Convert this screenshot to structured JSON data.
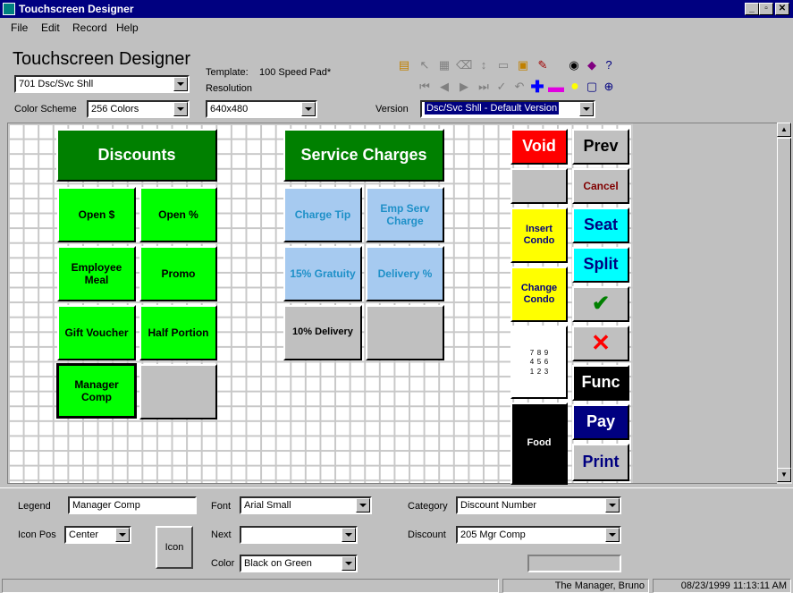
{
  "window": {
    "title": "Touchscreen Designer"
  },
  "menu": [
    "File",
    "Edit",
    "Record",
    "Help"
  ],
  "header": {
    "app_title": "Touchscreen Designer",
    "screen_select": "701  Dsc/Svc Shll",
    "template_label": "Template:",
    "template_value": "100 Speed Pad*",
    "resolution_label": "Resolution",
    "resolution_value": "640x480",
    "color_scheme_label": "Color Scheme",
    "color_scheme_value": "256 Colors",
    "version_label": "Version",
    "version_value": "Dsc/Svc Shll - Default Version"
  },
  "toolbar_icons": [
    "open-icon",
    "cursor-icon",
    "copy-icon",
    "delete-icon",
    "sort-icon",
    "paste-icon",
    "new-icon",
    "wand-icon",
    "find-icon",
    "book-icon",
    "help-icon",
    "first-icon",
    "prev-icon",
    "next-icon",
    "last-icon",
    "check-icon",
    "undo-icon",
    "add-icon",
    "remove-icon",
    "speech-icon",
    "monitor-icon",
    "network-icon"
  ],
  "touch_buttons": {
    "discounts": "Discounts",
    "service_charges": "Service Charges",
    "open_dollar": "Open $",
    "open_pct": "Open %",
    "employee_meal": "Employee Meal",
    "promo": "Promo",
    "gift_voucher": "Gift Voucher",
    "half_portion": "Half Portion",
    "manager_comp": "Manager Comp",
    "charge_tip": "Charge Tip",
    "emp_serv_charge": "Emp Serv Charge",
    "gratuity": "15% Gratuity",
    "delivery_pct": "Delivery %",
    "delivery_10": "10% Delivery",
    "void": "Void",
    "prev": "Prev",
    "cancel": "Cancel",
    "insert_condo": "Insert Condo",
    "seat": "Seat",
    "split": "Split",
    "change_condo": "Change Condo",
    "keypad": [
      "7",
      "8",
      "9",
      "4",
      "5",
      "6",
      "1",
      "2",
      "3"
    ],
    "func": "Func",
    "food": "Food",
    "pay": "Pay",
    "print": "Print"
  },
  "properties": {
    "legend_label": "Legend",
    "legend_value": "Manager Comp",
    "icon_pos_label": "Icon Pos",
    "icon_pos_value": "Center",
    "icon_button": "Icon",
    "font_label": "Font",
    "font_value": "Arial Small",
    "next_label": "Next",
    "next_value": "",
    "color_label": "Color",
    "color_value": "Black on Green",
    "category_label": "Category",
    "category_value": "Discount Number",
    "discount_label": "Discount",
    "discount_value": "205  Mgr Comp"
  },
  "status": {
    "user": "The Manager, Bruno",
    "datetime": "08/23/1999 11:13:11 AM"
  },
  "colors": {
    "titlebar": "#000080",
    "green": "#00ff00",
    "dark_green": "#008000",
    "light_blue": "#a6caf0"
  }
}
